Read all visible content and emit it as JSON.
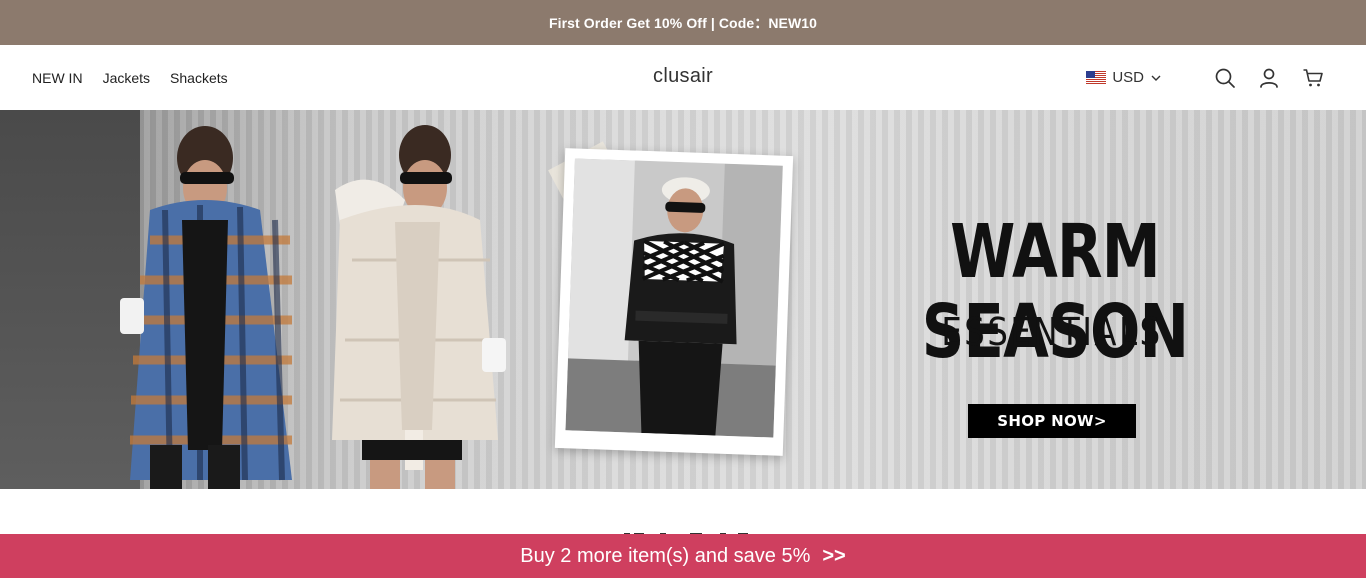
{
  "announcement": {
    "text": "First Order Get 10% Off | Code：NEW10"
  },
  "header": {
    "nav": [
      {
        "label": "NEW IN"
      },
      {
        "label": "Jackets"
      },
      {
        "label": "Shackets"
      }
    ],
    "logo": "clusair",
    "currency": "USD",
    "icons": [
      "us-flag-icon",
      "chevron-down-icon",
      "search-icon",
      "account-icon",
      "cart-icon"
    ]
  },
  "hero": {
    "headline": "WARM SEASON",
    "subline": "ESSENTIALS",
    "cta_label": "SHOP NOW>"
  },
  "promo_bar": {
    "text": "Buy 2 more item(s) and save 5%",
    "arrows": ">>"
  },
  "colors": {
    "announcement_bg": "#8c7a6d",
    "promo_bg": "#cf3f5f",
    "cta_bg": "#000000"
  }
}
